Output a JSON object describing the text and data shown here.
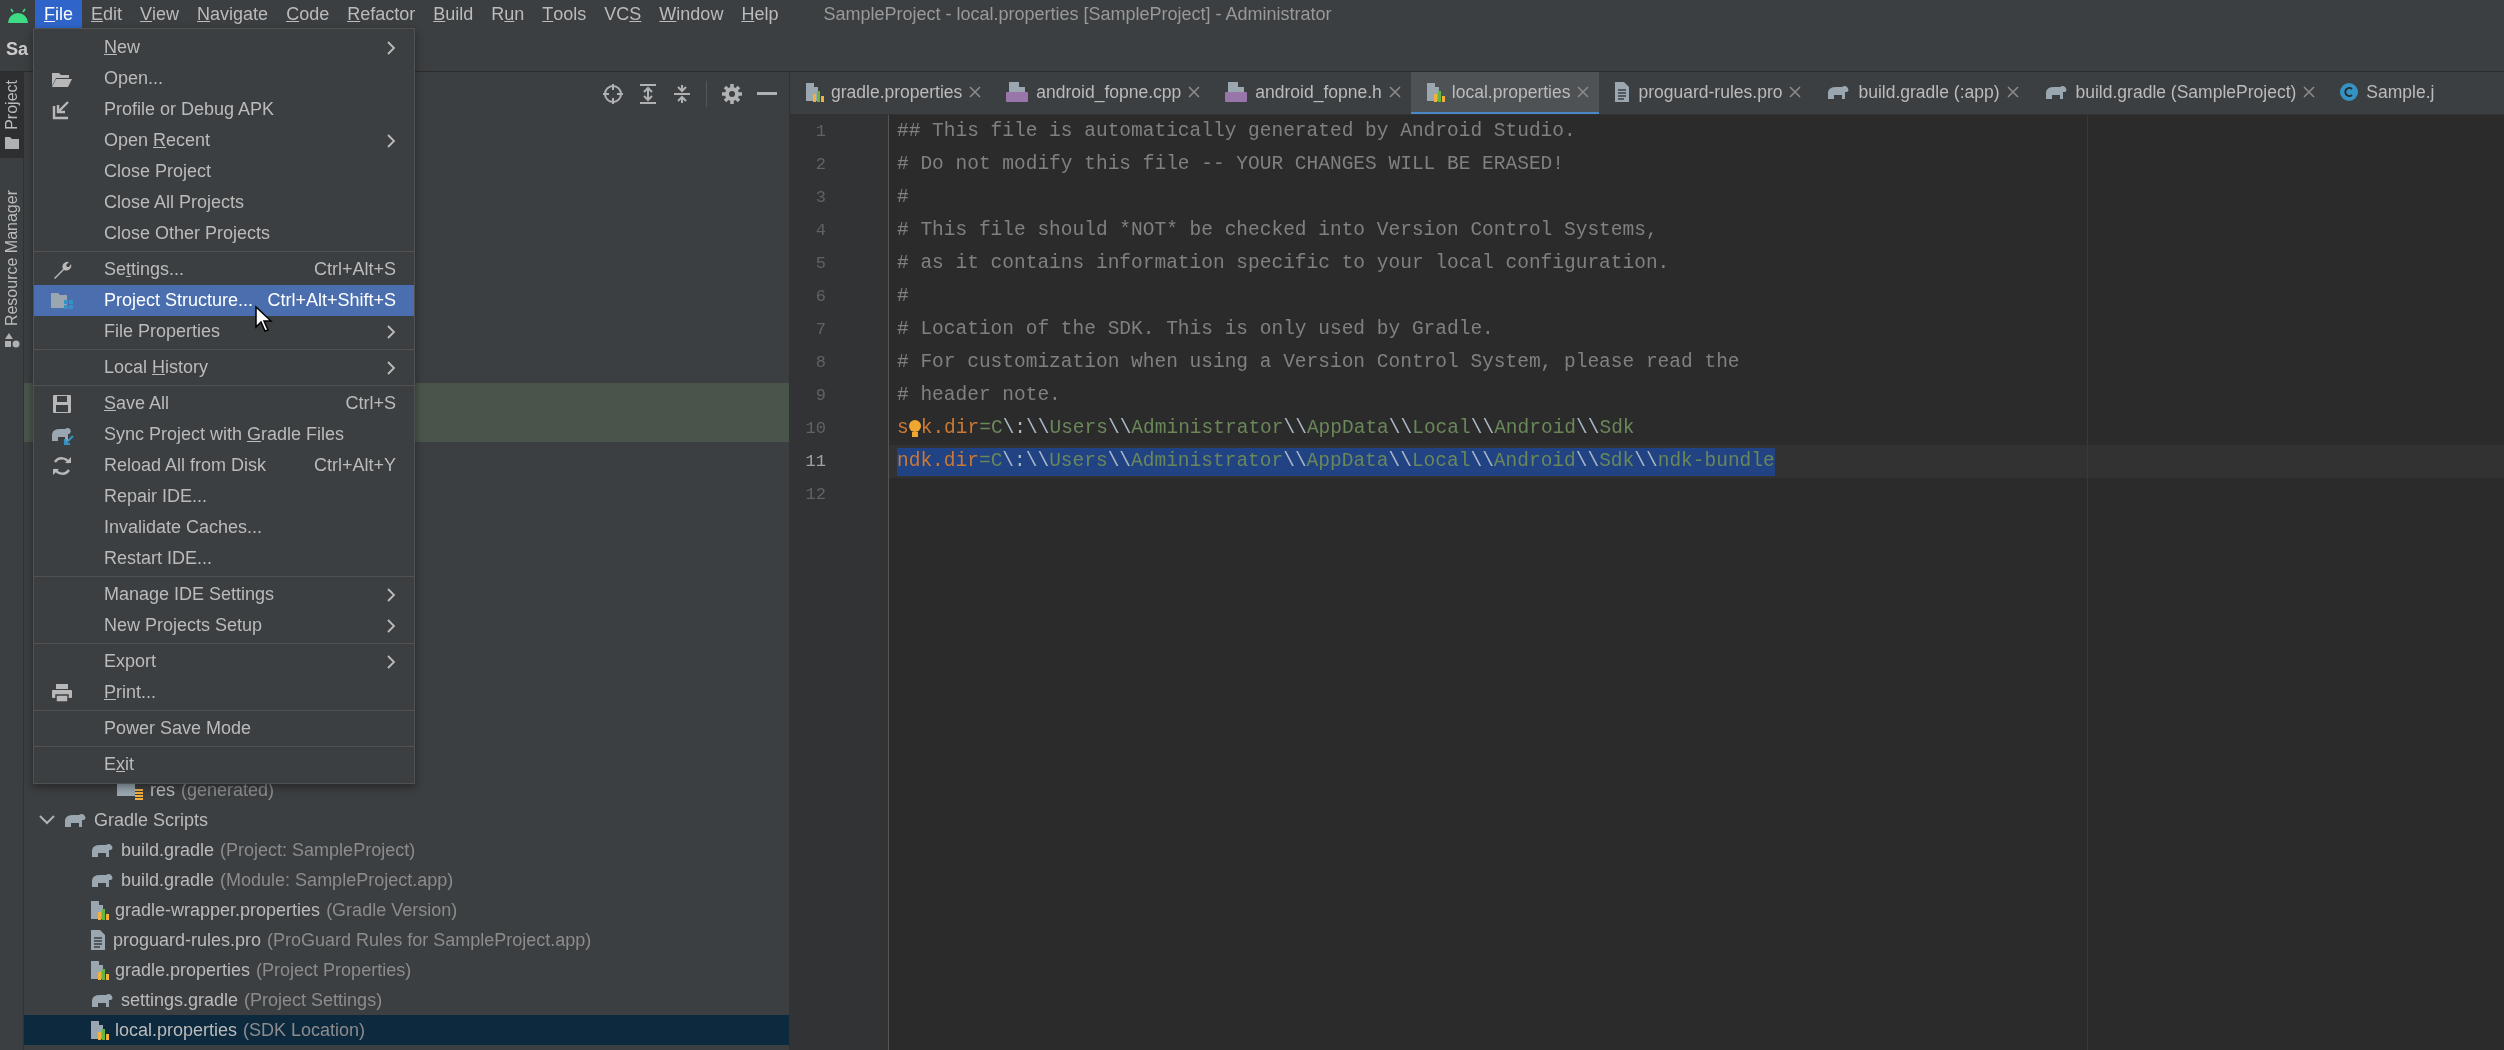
{
  "window": {
    "title": "SampleProject - local.properties [SampleProject] - Administrator"
  },
  "menubar": [
    {
      "label": {
        "mnemonic": "F",
        "after": "ile"
      },
      "selected": true
    },
    {
      "label": {
        "mnemonic": "E",
        "after": "dit"
      },
      "selected": false
    },
    {
      "label": {
        "mnemonic": "V",
        "after": "iew"
      },
      "selected": false
    },
    {
      "label": {
        "mnemonic": "N",
        "after": "avigate"
      },
      "selected": false
    },
    {
      "label": {
        "mnemonic": "C",
        "after": "ode"
      },
      "selected": false
    },
    {
      "label": {
        "mnemonic": "R",
        "after": "efactor"
      },
      "selected": false
    },
    {
      "label": {
        "mnemonic": "B",
        "after": "uild"
      },
      "selected": false
    },
    {
      "label": {
        "before": "R",
        "mnemonic": "u",
        "after": "n"
      },
      "selected": false
    },
    {
      "label": {
        "mnemonic": "T",
        "after": "ools"
      },
      "selected": false
    },
    {
      "label": {
        "before": "VC",
        "mnemonic": "S"
      },
      "selected": false
    },
    {
      "label": {
        "mnemonic": "W",
        "after": "indow"
      },
      "selected": false
    },
    {
      "label": {
        "mnemonic": "H",
        "after": "elp"
      },
      "selected": false
    }
  ],
  "navbar": {
    "text": "Sa"
  },
  "left_strip": [
    {
      "label": "Project",
      "kind": "folder",
      "selected": true
    },
    {
      "label": "Resource Manager",
      "kind": "shapes",
      "selected": false
    }
  ],
  "file_menu": [
    {
      "label": {
        "mnemonic": "N",
        "after": "ew"
      },
      "submenu": true,
      "selected": false
    },
    {
      "label": "Open...",
      "kind": "open",
      "selected": false
    },
    {
      "label": "Profile or Debug APK",
      "kind": "import",
      "selected": false
    },
    {
      "label": {
        "before": "Open ",
        "mnemonic": "R",
        "after": "ecent"
      },
      "submenu": true,
      "selected": false
    },
    {
      "label": "Close Project",
      "selected": false
    },
    {
      "label": "Close All Projects",
      "selected": false
    },
    {
      "label": "Close Other Projects",
      "selected": false,
      "separator_after": true
    },
    {
      "label": {
        "before": "Se",
        "mnemonic": "t",
        "after": "tings..."
      },
      "kind": "settings",
      "shortcut": "Ctrl+Alt+S",
      "selected": false
    },
    {
      "label": "Project Structure...",
      "kind": "structure",
      "shortcut": "Ctrl+Alt+Shift+S",
      "selected": true
    },
    {
      "label": "File Properties",
      "submenu": true,
      "selected": false,
      "separator_after": true
    },
    {
      "label": {
        "before": "Local ",
        "mnemonic": "H",
        "after": "istory"
      },
      "submenu": true,
      "selected": false,
      "separator_after": true
    },
    {
      "label": {
        "mnemonic": "S",
        "after": "ave All"
      },
      "kind": "save",
      "shortcut": "Ctrl+S",
      "selected": false
    },
    {
      "label": {
        "before": "Sync Project with ",
        "mnemonic": "G",
        "after": "radle Files"
      },
      "kind": "sync",
      "selected": false
    },
    {
      "label": "Reload All from Disk",
      "kind": "reload",
      "shortcut": "Ctrl+Alt+Y",
      "selected": false
    },
    {
      "label": "Repair IDE...",
      "selected": false
    },
    {
      "label": "Invalidate Caches...",
      "selected": false
    },
    {
      "label": "Restart IDE...",
      "selected": false,
      "separator_after": true
    },
    {
      "label": "Manage IDE Settings",
      "submenu": true,
      "selected": false
    },
    {
      "label": "New Projects Setup",
      "submenu": true,
      "selected": false,
      "separator_after": true
    },
    {
      "label": "Export",
      "submenu": true,
      "selected": false
    },
    {
      "label": {
        "mnemonic": "P",
        "after": "rint..."
      },
      "kind": "print",
      "selected": false,
      "separator_after": true
    },
    {
      "label": "Power Save Mode",
      "selected": false,
      "separator_after": true
    },
    {
      "label": {
        "before": "E",
        "mnemonic": "x",
        "after": "it"
      },
      "selected": false
    }
  ],
  "tree": {
    "continued_children": [
      {
        "label": "res",
        "hint": "(generated)",
        "kind": "res",
        "selected": false
      }
    ],
    "items": [
      {
        "label": "Gradle Scripts",
        "kind": "gradle",
        "expanded": true,
        "selected": false,
        "children": [
          {
            "label": "build.gradle",
            "hint": "(Project: SampleProject)",
            "kind": "gradle",
            "selected": false
          },
          {
            "label": "build.gradle",
            "hint": "(Module: SampleProject.app)",
            "kind": "gradle",
            "selected": false
          },
          {
            "label": "gradle-wrapper.properties",
            "hint": "(Gradle Version)",
            "kind": "props",
            "selected": false
          },
          {
            "label": "proguard-rules.pro",
            "hint": "(ProGuard Rules for SampleProject.app)",
            "kind": "text",
            "selected": false
          },
          {
            "label": "gradle.properties",
            "hint": "(Project Properties)",
            "kind": "props",
            "selected": false
          },
          {
            "label": "settings.gradle",
            "hint": "(Project Settings)",
            "kind": "gradle",
            "selected": false
          },
          {
            "label": "local.properties",
            "hint": "(SDK Location)",
            "kind": "props",
            "selected": true
          }
        ]
      }
    ]
  },
  "tabs": [
    {
      "label": "gradle.properties",
      "kind": "props",
      "selected": false,
      "closable": true
    },
    {
      "label": "android_fopne.cpp",
      "kind": "cpp",
      "selected": false,
      "closable": true
    },
    {
      "label": "android_fopne.h",
      "kind": "header",
      "selected": false,
      "closable": true
    },
    {
      "label": "local.properties",
      "kind": "props",
      "selected": true,
      "closable": true
    },
    {
      "label": "proguard-rules.pro",
      "kind": "text",
      "selected": false,
      "closable": true
    },
    {
      "label": "build.gradle (:app)",
      "kind": "gradle",
      "selected": false,
      "closable": true
    },
    {
      "label": "build.gradle (SampleProject)",
      "kind": "gradle",
      "selected": false,
      "closable": true
    },
    {
      "label": "Sample.j",
      "kind": "class",
      "selected": false,
      "closable": false
    }
  ],
  "code": [
    {
      "number": "1",
      "current": false,
      "selected": false,
      "tokens": [
        {
          "kind": "comment",
          "text": "## This file is automatically generated by Android Studio."
        }
      ]
    },
    {
      "number": "2",
      "current": false,
      "selected": false,
      "tokens": [
        {
          "kind": "comment",
          "text": "# Do not modify this file -- YOUR CHANGES WILL BE ERASED!"
        }
      ]
    },
    {
      "number": "3",
      "current": false,
      "selected": false,
      "tokens": [
        {
          "kind": "comment",
          "text": "#"
        }
      ]
    },
    {
      "number": "4",
      "current": false,
      "selected": false,
      "tokens": [
        {
          "kind": "comment",
          "text": "# This file should *NOT* be checked into Version Control Systems,"
        }
      ]
    },
    {
      "number": "5",
      "current": false,
      "selected": false,
      "tokens": [
        {
          "kind": "comment",
          "text": "# as it contains information specific to your local configuration."
        }
      ]
    },
    {
      "number": "6",
      "current": false,
      "selected": false,
      "tokens": [
        {
          "kind": "comment",
          "text": "#"
        }
      ]
    },
    {
      "number": "7",
      "current": false,
      "selected": false,
      "tokens": [
        {
          "kind": "comment",
          "text": "# Location of the SDK. This is only used by Gradle."
        }
      ]
    },
    {
      "number": "8",
      "current": false,
      "selected": false,
      "tokens": [
        {
          "kind": "comment",
          "text": "# For customization when using a Version Control System, please read the"
        }
      ]
    },
    {
      "number": "9",
      "current": false,
      "selected": false,
      "tokens": [
        {
          "kind": "comment",
          "text": "# header note."
        }
      ]
    },
    {
      "number": "10",
      "current": false,
      "selected": false,
      "tokens": [
        {
          "kind": "key",
          "text": "s"
        },
        {
          "kind": "bulb"
        },
        {
          "kind": "key",
          "text": "k.dir"
        },
        {
          "kind": "sep",
          "text": "="
        },
        {
          "kind": "value",
          "text": "C"
        },
        {
          "kind": "escape",
          "text": "\\:"
        },
        {
          "kind": "escape",
          "text": "\\\\"
        },
        {
          "kind": "value",
          "text": "Users"
        },
        {
          "kind": "escape",
          "text": "\\\\"
        },
        {
          "kind": "value",
          "text": "Administrator"
        },
        {
          "kind": "escape",
          "text": "\\\\"
        },
        {
          "kind": "value",
          "text": "AppData"
        },
        {
          "kind": "escape",
          "text": "\\\\"
        },
        {
          "kind": "value",
          "text": "Local"
        },
        {
          "kind": "escape",
          "text": "\\\\"
        },
        {
          "kind": "value",
          "text": "Android"
        },
        {
          "kind": "escape",
          "text": "\\\\"
        },
        {
          "kind": "value",
          "text": "Sdk"
        }
      ]
    },
    {
      "number": "11",
      "current": true,
      "selected": true,
      "tokens": [
        {
          "kind": "key",
          "text": "ndk.dir"
        },
        {
          "kind": "sep",
          "text": "="
        },
        {
          "kind": "value",
          "text": "C"
        },
        {
          "kind": "escape",
          "text": "\\:"
        },
        {
          "kind": "escape",
          "text": "\\\\"
        },
        {
          "kind": "value",
          "text": "Users"
        },
        {
          "kind": "escape",
          "text": "\\\\"
        },
        {
          "kind": "value",
          "text": "Administrator"
        },
        {
          "kind": "escape",
          "text": "\\\\"
        },
        {
          "kind": "value",
          "text": "AppData"
        },
        {
          "kind": "escape",
          "text": "\\\\"
        },
        {
          "kind": "value",
          "text": "Local"
        },
        {
          "kind": "escape",
          "text": "\\\\"
        },
        {
          "kind": "value",
          "text": "Android"
        },
        {
          "kind": "escape",
          "text": "\\\\"
        },
        {
          "kind": "value",
          "text": "Sdk"
        },
        {
          "kind": "escape",
          "text": "\\\\"
        },
        {
          "kind": "value",
          "text": "ndk-bundle"
        }
      ]
    },
    {
      "number": "12",
      "current": false
    }
  ]
}
